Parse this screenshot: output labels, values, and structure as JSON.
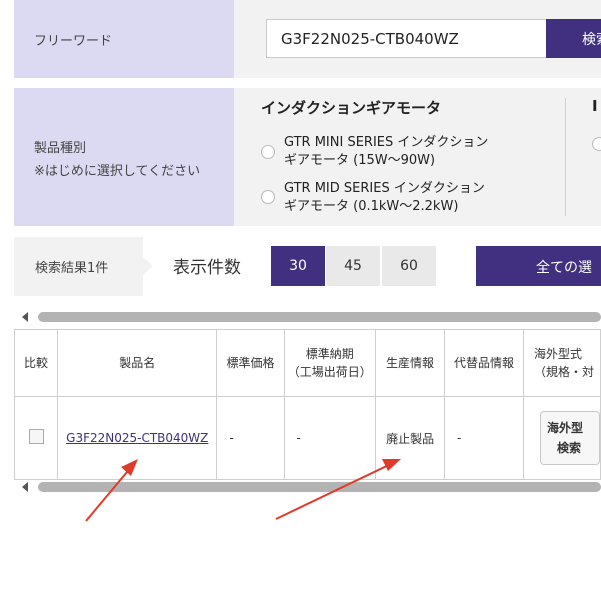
{
  "freeword": {
    "label": "フリーワード",
    "value": "G3F22N025-CTB040WZ",
    "search_label": "検索"
  },
  "product_type": {
    "label": "製品種別",
    "note": "※はじめに選択してください",
    "group_title": "インダクションギアモータ",
    "options": [
      {
        "line1": "GTR MINI SERIES インダクション",
        "line2": "ギアモータ (15W〜90W)"
      },
      {
        "line1": "GTR MID SERIES インダクション",
        "line2": "ギアモータ (0.1kW〜2.2kW)"
      }
    ],
    "next_group_peek": "I"
  },
  "results": {
    "count_label": "検索結果1件",
    "per_page_label": "表示件数",
    "per_page_options": [
      "30",
      "45",
      "60"
    ],
    "per_page_selected": "30",
    "select_all_label": "全ての選"
  },
  "table": {
    "headers": {
      "compare": "比較",
      "product_name": "製品名",
      "price_std": "標準価格",
      "lead_time_line1": "標準納期",
      "lead_time_line2": "（工場出荷日）",
      "production": "生産情報",
      "alternative": "代替品情報",
      "overseas_line1": "海外型式",
      "overseas_line2": "（規格・対"
    },
    "rows": [
      {
        "product_name": "G3F22N025-CTB040WZ",
        "price_std": "-",
        "lead_time": "-",
        "production": "廃止製品",
        "alternative": "-",
        "overseas_btn_line1": "海外型",
        "overseas_btn_line2": "検索"
      }
    ]
  },
  "colors": {
    "accent": "#41307f",
    "panel_lavender": "#dcdaf2",
    "annotation_arrow": "#e03a2a"
  }
}
